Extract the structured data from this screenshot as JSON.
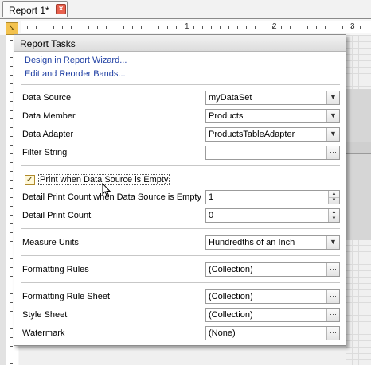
{
  "tab": {
    "label": "Report 1*",
    "close_icon": "close-icon"
  },
  "ruler": {
    "numbers": [
      "1",
      "2",
      "3"
    ]
  },
  "popup": {
    "title": "Report Tasks",
    "links": [
      "Design in Report Wizard...",
      "Edit and Reorder Bands..."
    ],
    "data_source": {
      "label": "Data Source",
      "value": "myDataSet"
    },
    "data_member": {
      "label": "Data Member",
      "value": "Products"
    },
    "data_adapter": {
      "label": "Data Adapter",
      "value": "ProductsTableAdapter"
    },
    "filter_string": {
      "label": "Filter String",
      "value": ""
    },
    "print_empty": {
      "label": "Print when Data Source is Empty",
      "checked": true
    },
    "detail_count_empty": {
      "label": "Detail Print Count when Data Source is Empty",
      "value": "1"
    },
    "detail_count": {
      "label": "Detail Print Count",
      "value": "0"
    },
    "measure_units": {
      "label": "Measure Units",
      "value": "Hundredths of an Inch"
    },
    "formatting_rules": {
      "label": "Formatting Rules",
      "value": "(Collection)"
    },
    "formatting_rule_sheet": {
      "label": "Formatting Rule Sheet",
      "value": "(Collection)"
    },
    "style_sheet": {
      "label": "Style Sheet",
      "value": "(Collection)"
    },
    "watermark": {
      "label": "Watermark",
      "value": "(None)"
    }
  }
}
